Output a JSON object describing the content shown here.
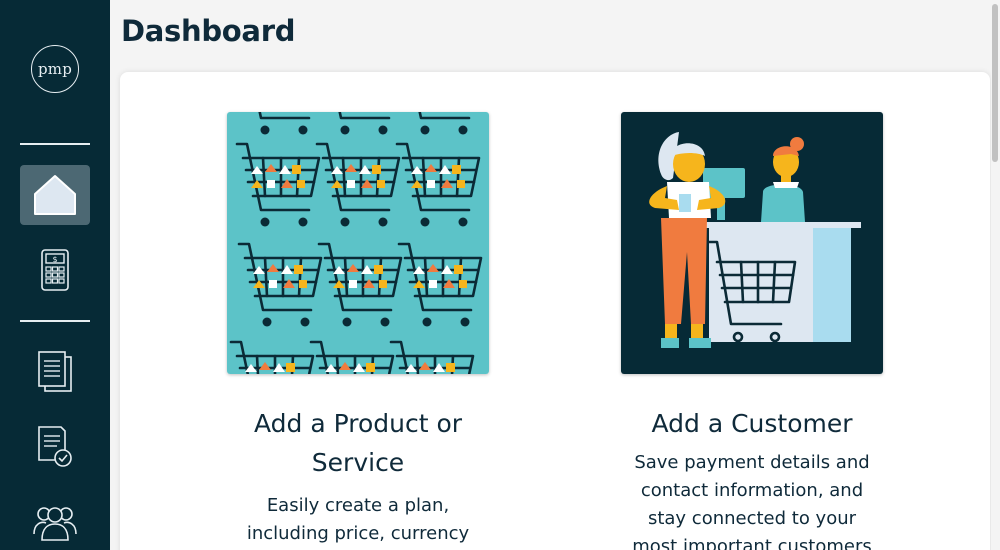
{
  "sidebar": {
    "logo_text": "pmp",
    "items": [
      {
        "name": "home",
        "icon": "home-icon",
        "active": true
      },
      {
        "name": "calculator",
        "icon": "calculator-icon",
        "active": false
      },
      {
        "name": "documents",
        "icon": "documents-icon",
        "active": false
      },
      {
        "name": "approved-documents",
        "icon": "document-check-icon",
        "active": false
      },
      {
        "name": "customers",
        "icon": "users-icon",
        "active": false
      }
    ],
    "calculator_symbol": "$"
  },
  "page": {
    "title": "Dashboard"
  },
  "tiles": [
    {
      "title": "Add a Product or Service",
      "description": "Easily create a plan, including price, currency and billing",
      "illustration": "shopping-carts-pattern"
    },
    {
      "title": "Add a Customer",
      "description": "Save payment details and contact information, and stay connected to your most important customers",
      "illustration": "checkout-counter"
    }
  ],
  "colors": {
    "sidebar_bg": "#062a36",
    "active_item_bg": "#4c6873",
    "page_bg": "#f4f4f4",
    "text_dark": "#0f2a3a",
    "teal": "#5cc3c8",
    "orange": "#f07b3f",
    "yellow": "#f6b51c"
  }
}
